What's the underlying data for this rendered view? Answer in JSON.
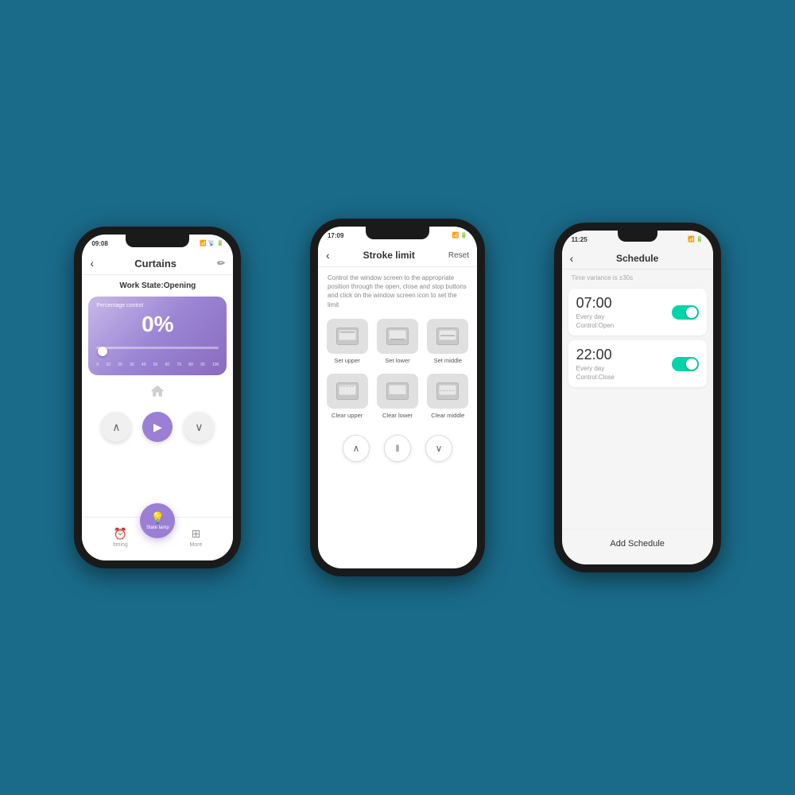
{
  "background": "#1a6b8a",
  "phone1": {
    "time": "09:08",
    "title": "Curtains",
    "workState": "Work State:Opening",
    "percentage": "0%",
    "percentageLabel": "Percentage control",
    "sliderNumbers": [
      "0",
      "10",
      "20",
      "30",
      "40",
      "50",
      "60",
      "70",
      "80",
      "90",
      "100"
    ],
    "navItems": [
      {
        "label": "timing",
        "icon": "⏰"
      },
      {
        "label": "More",
        "icon": "⊞"
      }
    ],
    "fabLabel": "State lamp",
    "sysButtons": [
      "≡",
      "□",
      "◁"
    ]
  },
  "phone2": {
    "time": "17:09",
    "title": "Stroke limit",
    "reset": "Reset",
    "description": "Control the window screen to the appropriate position through the open, close and stop buttons and click on the window screen icon to set the limit",
    "topRow": [
      {
        "label": "Set upper"
      },
      {
        "label": "Set lower"
      },
      {
        "label": "Set middle"
      }
    ],
    "bottomRow": [
      {
        "label": "Clear upper"
      },
      {
        "label": "Clear lower"
      },
      {
        "label": "Clear middle"
      }
    ]
  },
  "phone3": {
    "time": "11:25",
    "title": "Schedule",
    "variance": "Time variance is ±30s",
    "schedules": [
      {
        "time": "07:00",
        "repeat": "Every day",
        "control": "Control:Open",
        "enabled": true
      },
      {
        "time": "22:00",
        "repeat": "Every day",
        "control": "Control:Close",
        "enabled": true
      }
    ],
    "addLabel": "Add Schedule"
  }
}
